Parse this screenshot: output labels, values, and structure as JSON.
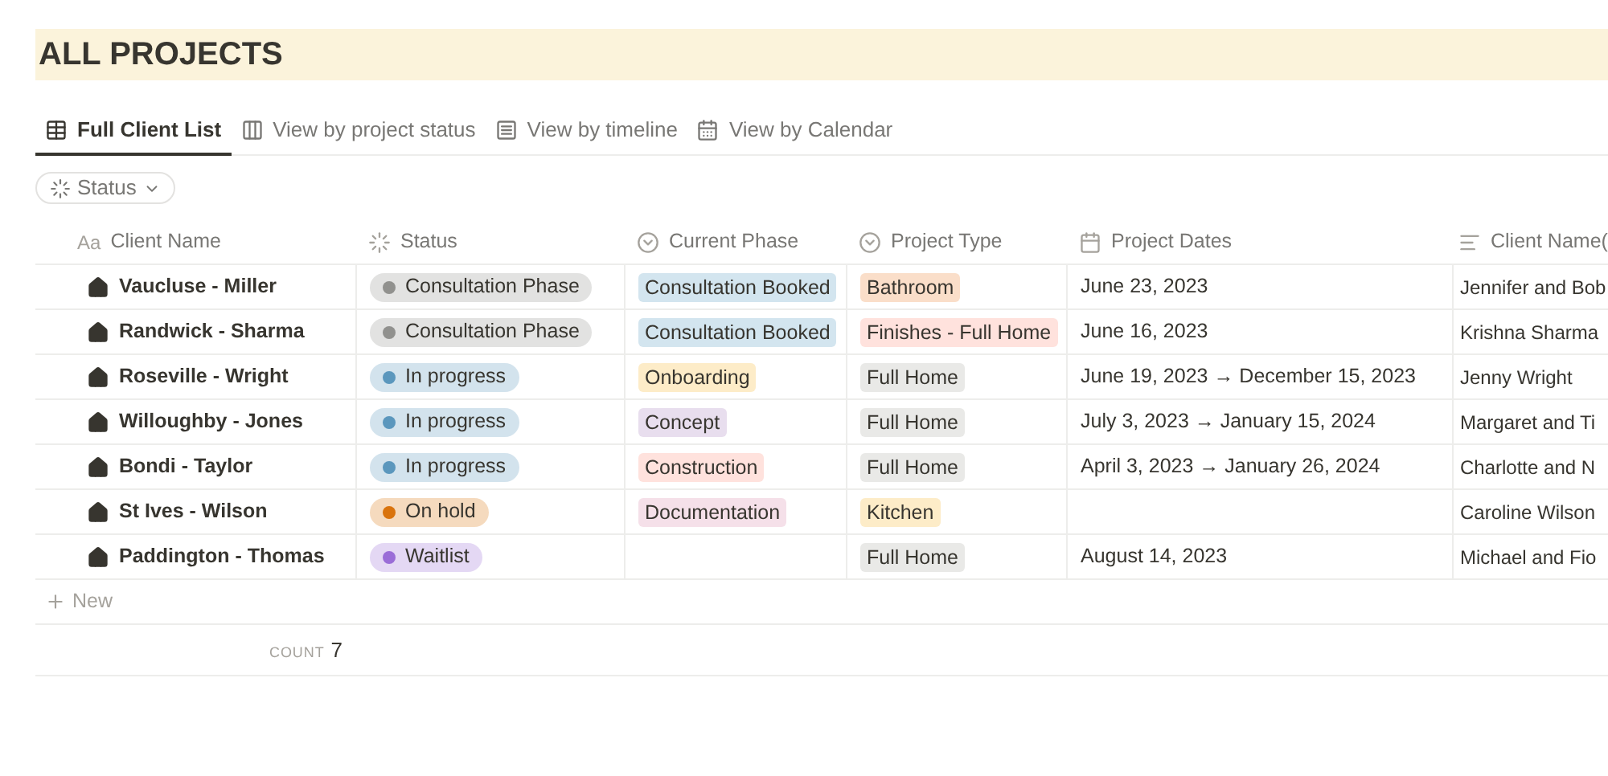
{
  "page": {
    "title": "ALL PROJECTS"
  },
  "tabs": [
    {
      "label": "Full Client List",
      "kind": "table",
      "selected": true
    },
    {
      "label": "View by project status",
      "kind": "board",
      "selected": false
    },
    {
      "label": "View by timeline",
      "kind": "timeline",
      "selected": false
    },
    {
      "label": "View by Calendar",
      "kind": "calendar",
      "selected": false
    }
  ],
  "filter": {
    "label": "Status"
  },
  "table": {
    "columns": [
      {
        "label": "Client Name",
        "kind": "title",
        "icon_text": "Aa"
      },
      {
        "label": "Status",
        "kind": "status"
      },
      {
        "label": "Current Phase",
        "kind": "select"
      },
      {
        "label": "Project Type",
        "kind": "select"
      },
      {
        "label": "Project Dates",
        "kind": "date"
      },
      {
        "label": "Client Name(",
        "kind": "text"
      }
    ],
    "rows": [
      {
        "cells": [
          "Vaucluse - Miller",
          {
            "label": "Consultation Phase",
            "color": "#91918e"
          },
          {
            "label": "Consultation Booked",
            "color": "#d3e5ef"
          },
          {
            "label": "Bathroom",
            "color": "#fadec9"
          },
          "June 23, 2023",
          "Jennifer and Bob"
        ]
      },
      {
        "cells": [
          "Randwick - Sharma",
          {
            "label": "Consultation Phase",
            "color": "#91918e"
          },
          {
            "label": "Consultation Booked",
            "color": "#d3e5ef"
          },
          {
            "label": "Finishes - Full Home",
            "color": "#ffe2dd"
          },
          "June 16, 2023",
          "Krishna Sharma"
        ]
      },
      {
        "cells": [
          "Roseville - Wright",
          {
            "label": "In progress",
            "color": "#5b97bd"
          },
          {
            "label": "Onboarding",
            "color": "#fdecc8"
          },
          {
            "label": "Full Home",
            "color": "#e9e9e7"
          },
          "June 19, 2023 → December 15, 2023",
          "Jenny Wright"
        ]
      },
      {
        "cells": [
          "Willoughby - Jones",
          {
            "label": "In progress",
            "color": "#5b97bd"
          },
          {
            "label": "Concept",
            "color": "#e8deee"
          },
          {
            "label": "Full Home",
            "color": "#e9e9e7"
          },
          "July 3, 2023 → January 15, 2024",
          "Margaret and Ti"
        ]
      },
      {
        "cells": [
          "Bondi - Taylor",
          {
            "label": "In progress",
            "color": "#5b97bd"
          },
          {
            "label": "Construction",
            "color": "#ffe2dd"
          },
          {
            "label": "Full Home",
            "color": "#e9e9e7"
          },
          "April 3, 2023 → January 26, 2024",
          "Charlotte and N"
        ]
      },
      {
        "cells": [
          "St Ives - Wilson",
          {
            "label": "On hold",
            "color": "#d9730d"
          },
          {
            "label": "Documentation",
            "color": "#f5e0e9"
          },
          {
            "label": "Kitchen",
            "color": "#fdecc8"
          },
          null,
          "Caroline Wilson"
        ]
      },
      {
        "cells": [
          "Paddington - Thomas",
          {
            "label": "Waitlist",
            "color": "#9a6dd7"
          },
          null,
          {
            "label": "Full Home",
            "color": "#e9e9e7"
          },
          "August 14, 2023",
          "Michael and Fio"
        ]
      }
    ],
    "new_row": {
      "label": "New"
    },
    "footer": {
      "label": "COUNT",
      "value": "7"
    }
  }
}
